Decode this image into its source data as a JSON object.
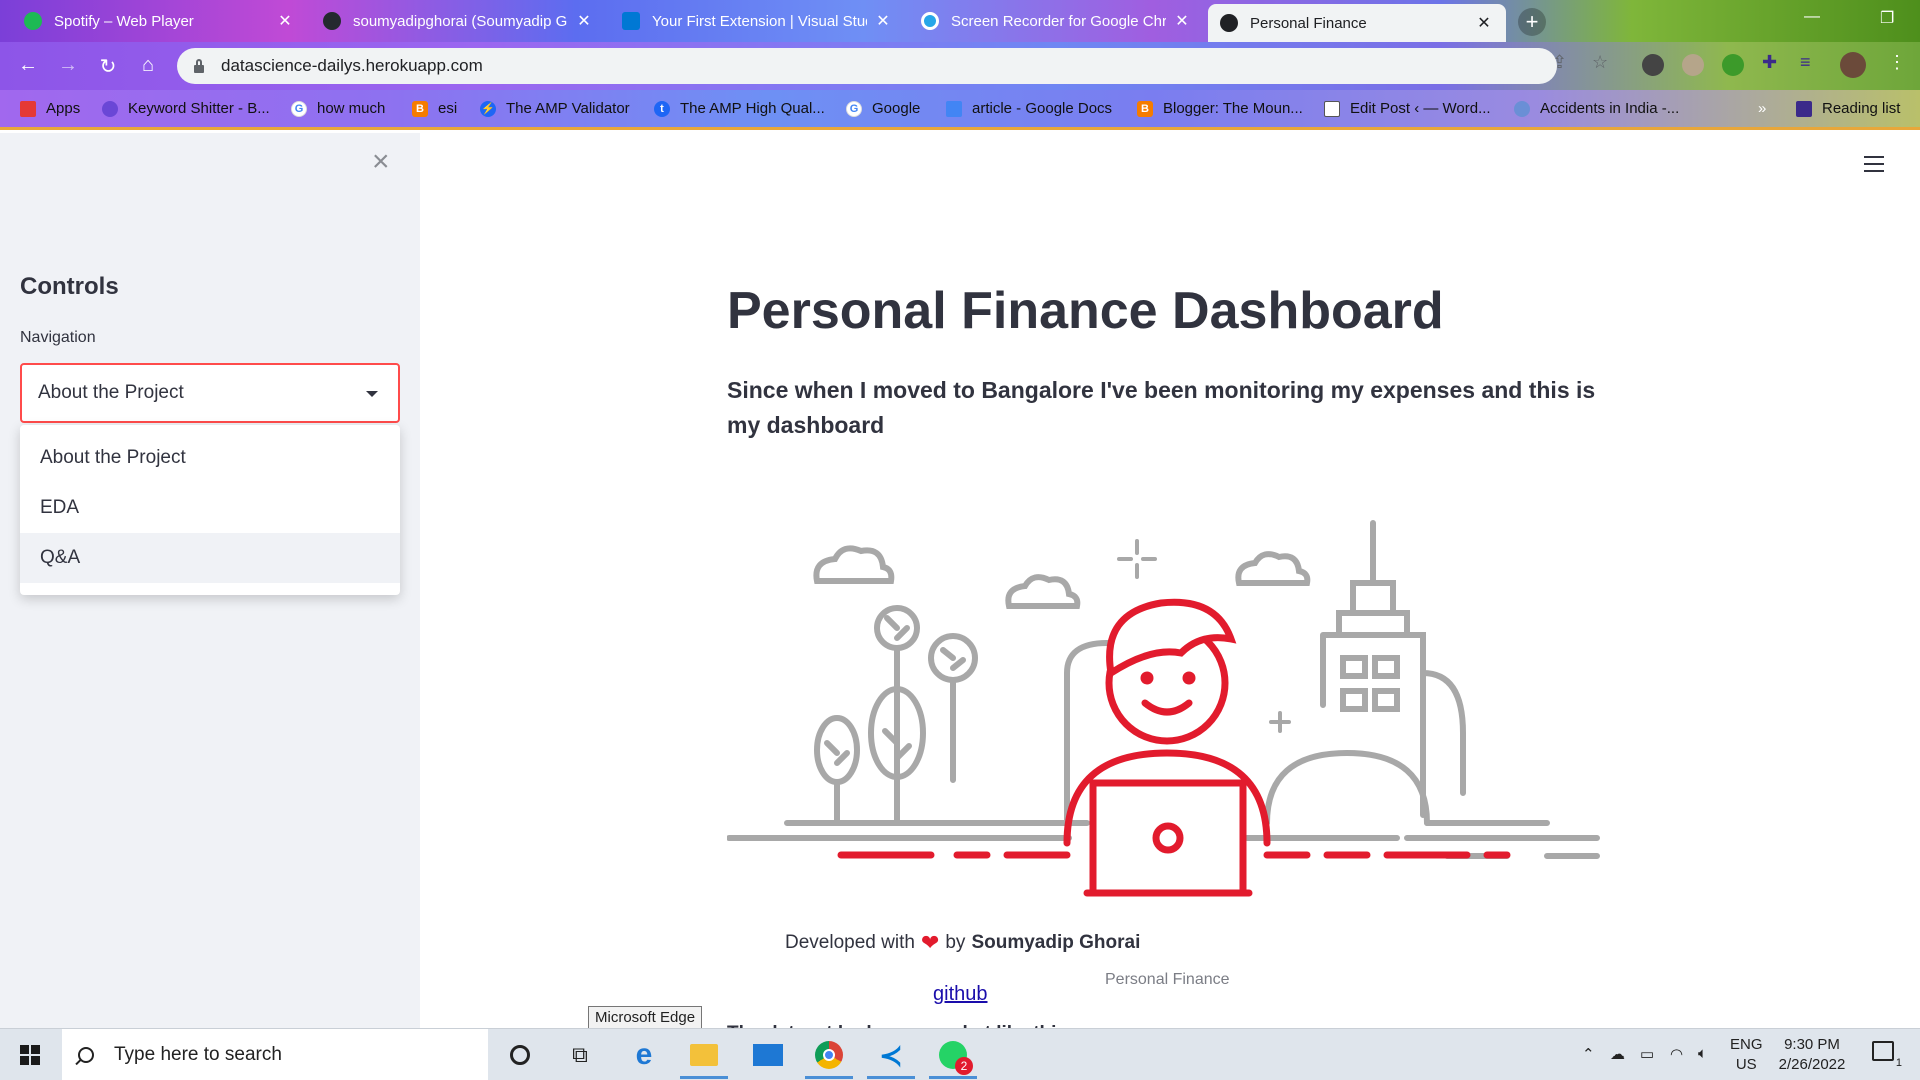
{
  "browser": {
    "tabs": [
      {
        "title": "Spotify – Web Player",
        "icon": "spotify-icon",
        "color": "#1db954"
      },
      {
        "title": "soumyadipghorai (Soumyadip G",
        "icon": "github-icon",
        "color": "#24292f"
      },
      {
        "title": "Your First Extension | Visual Studi",
        "icon": "vscode-icon",
        "color": "#0078d4"
      },
      {
        "title": "Screen Recorder for Google Chro",
        "icon": "screen-recorder-icon",
        "color": "#27a6e8"
      },
      {
        "title": "Personal Finance",
        "icon": "streamlit-icon",
        "color": "#ff4b4b"
      }
    ],
    "url": "datascience-dailys.herokuapp.com",
    "bookmarks": [
      {
        "label": "Apps",
        "icon": "apps-grid-icon",
        "color": "#e53935"
      },
      {
        "label": "Keyword Shitter - B...",
        "icon": "keyword-icon",
        "color": "#6a47d6"
      },
      {
        "label": "how much",
        "icon": "google-icon",
        "color": "#4285f4"
      },
      {
        "label": "esi",
        "icon": "blogger-icon",
        "color": "#f57c00"
      },
      {
        "label": "The AMP Validator",
        "icon": "amp-icon",
        "color": "#1e66f5"
      },
      {
        "label": "The AMP High Qual...",
        "icon": "tumblr-icon",
        "color": "#1e66f5"
      },
      {
        "label": "Google",
        "icon": "google-icon",
        "color": "#4285f4"
      },
      {
        "label": "article - Google Docs",
        "icon": "docs-icon",
        "color": "#4285f4"
      },
      {
        "label": "Blogger: The Moun...",
        "icon": "blogger-icon",
        "color": "#f57c00"
      },
      {
        "label": "Edit Post ‹ — Word...",
        "icon": "wordpress-icon",
        "color": "#555555"
      },
      {
        "label": "Accidents in India -...",
        "icon": "accidents-icon",
        "color": "#6a8fd6"
      }
    ],
    "more_bookmarks": "»",
    "reading_list": "Reading list"
  },
  "sidebar": {
    "heading": "Controls",
    "nav_label": "Navigation",
    "selected": "About the Project",
    "options": [
      "About the Project",
      "EDA",
      "Q&A"
    ]
  },
  "main": {
    "title": "Personal Finance Dashboard",
    "subtitle": "Since when I moved to Bangalore I've been monitoring my expenses and this is my dashboard",
    "dev_prefix": "Developed with",
    "dev_by": "by",
    "dev_name": "Soumyadip Ghorai",
    "image_caption": "Personal Finance",
    "github_link": "github",
    "cut_text": "The dataset looks some what like this"
  },
  "tooltip": "Microsoft Edge",
  "taskbar": {
    "search_placeholder": "Type here to search",
    "lang_top": "ENG",
    "lang_bottom": "US",
    "time": "9:30 PM",
    "date": "2/26/2022",
    "whatsapp_badge": "2",
    "notification_badge": "1"
  },
  "colors": {
    "accent": "#ff4b4b",
    "illustration_red": "#e21b2d",
    "text": "#31333f",
    "sidebar_bg": "#f0f2f6"
  }
}
